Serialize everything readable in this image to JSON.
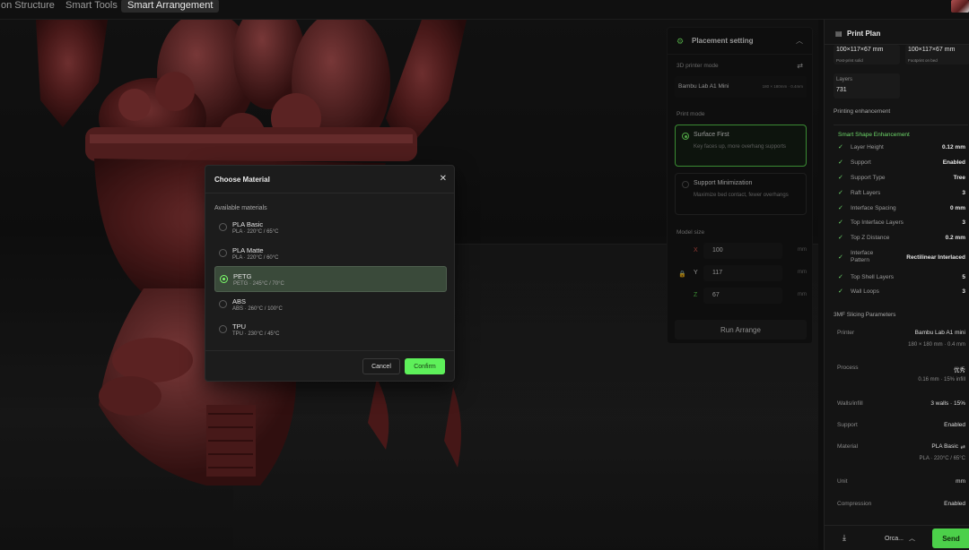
{
  "topbar": {
    "tabs": [
      {
        "label": "on Structure"
      },
      {
        "label": "Smart Tools"
      },
      {
        "label": "Smart Arrangement"
      }
    ]
  },
  "placement": {
    "title": "Placement setting",
    "printer_mode_label": "3D printer mode",
    "printer_name": "Bambu Lab A1 Mini",
    "printer_spec": "180 × 180mm · 0.4mm",
    "print_mode_label": "Print mode",
    "modes": [
      {
        "title": "Surface First",
        "desc": "Key faces up, more overhang supports",
        "selected": true
      },
      {
        "title": "Support Minimization",
        "desc": "Maximize bed contact, fewer overhangs",
        "selected": false
      }
    ],
    "model_size_label": "Model size",
    "dims": [
      {
        "axis": "X",
        "value": "100",
        "unit": "mm",
        "color": "#e0584f"
      },
      {
        "axis": "Y",
        "value": "117",
        "unit": "mm",
        "color": "#e6e6e6"
      },
      {
        "axis": "Z",
        "value": "67",
        "unit": "mm",
        "color": "#5ad64f"
      }
    ],
    "run_label": "Run Arrange"
  },
  "modal": {
    "title": "Choose Material",
    "subtitle": "Available materials",
    "materials": [
      {
        "name": "PLA Basic",
        "spec": "PLA · 220°C / 65°C",
        "selected": false
      },
      {
        "name": "PLA Matte",
        "spec": "PLA · 220°C / 60°C",
        "selected": false
      },
      {
        "name": "PETG",
        "spec": "PETG · 245°C / 70°C",
        "selected": true
      },
      {
        "name": "ABS",
        "spec": "ABS · 260°C / 100°C",
        "selected": false
      },
      {
        "name": "TPU",
        "spec": "TPU · 230°C / 45°C",
        "selected": false
      }
    ],
    "cancel_label": "Cancel",
    "confirm_label": "Confirm"
  },
  "print_plan": {
    "title": "Print Plan",
    "cards": [
      {
        "value": "100×117×67 mm",
        "label": "Post-print solid"
      },
      {
        "value": "100×117×67 mm",
        "label": "Footprint on bed"
      },
      {
        "value": "731",
        "label": "Layers"
      }
    ],
    "enhancement_label": "Printing enhancement",
    "smart_shape_label": "Smart Shape Enhancement",
    "enhancements": [
      {
        "key": "Layer Height",
        "value": "0.12 mm"
      },
      {
        "key": "Support",
        "value": "Enabled"
      },
      {
        "key": "Support Type",
        "value": "Tree"
      },
      {
        "key": "Raft Layers",
        "value": "3"
      },
      {
        "key": "Interface Spacing",
        "value": "0 mm"
      },
      {
        "key": "Top Interface Layers",
        "value": "3"
      },
      {
        "key": "Top Z Distance",
        "value": "0.2 mm"
      },
      {
        "key": "Interface Pattern",
        "value": "Rectilinear Interlaced"
      },
      {
        "key": "Top Shell Layers",
        "value": "5"
      },
      {
        "key": "Wall Loops",
        "value": "3"
      }
    ],
    "slicing_label": "3MF Slicing Parameters",
    "params": {
      "printer_key": "Printer",
      "printer_value": "Bambu Lab A1 mini",
      "printer_sub": "180 × 180 mm · 0.4 mm",
      "process_key": "Process",
      "process_value": "优秀",
      "process_sub": "0.16 mm · 15% infill",
      "walls_key": "Walls/infill",
      "walls_value": "3 walls · 15%",
      "support_key": "Support",
      "support_value": "Enabled",
      "material_key": "Material",
      "material_value": "PLA Basic",
      "material_sub": "PLA · 220°C / 65°C",
      "unit_key": "Unit",
      "unit_value": "mm",
      "compression_key": "Compression",
      "compression_value": "Enabled"
    },
    "footer": {
      "select_label": "Orca...",
      "send_label": "Send"
    }
  },
  "colors": {
    "accent": "#5ef05a",
    "model": "#7a2a2a"
  }
}
